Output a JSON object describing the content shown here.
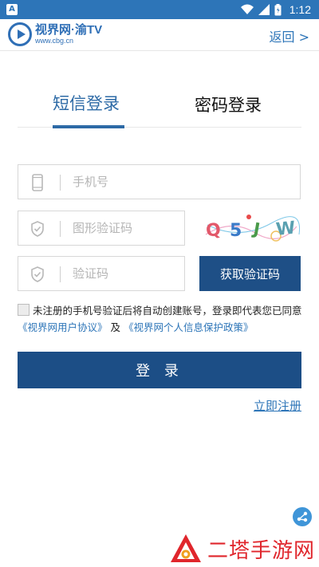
{
  "status_bar": {
    "app_badge": "A",
    "time": "1:12",
    "icons": [
      "wifi-icon",
      "signal-icon",
      "battery-icon"
    ]
  },
  "header": {
    "logo_name": "视界网·渝TV",
    "logo_url": "www.cbg.cn",
    "back_label": "返回 >"
  },
  "tabs": [
    {
      "label": "短信登录",
      "active": true
    },
    {
      "label": "密码登录",
      "active": false
    }
  ],
  "form": {
    "phone_placeholder": "手机号",
    "captcha_placeholder": "图形验证码",
    "captcha_text": "Q5JW",
    "code_placeholder": "验证码",
    "get_code_label": "获取验证码"
  },
  "agreement": {
    "text": "未注册的手机号验证后将自动创建账号，登录即代表您已同意",
    "user_agreement": "《视界网用户协议》",
    "and": "及",
    "privacy_policy": "《视界网个人信息保护政策》"
  },
  "login_label": "登 录",
  "register_label": "立即注册",
  "watermark": "二塔手游网",
  "colors": {
    "status_bar": "#2d75b8",
    "primary": "#1c4e86",
    "link": "#2d75b8",
    "watermark": "#e0262c"
  }
}
